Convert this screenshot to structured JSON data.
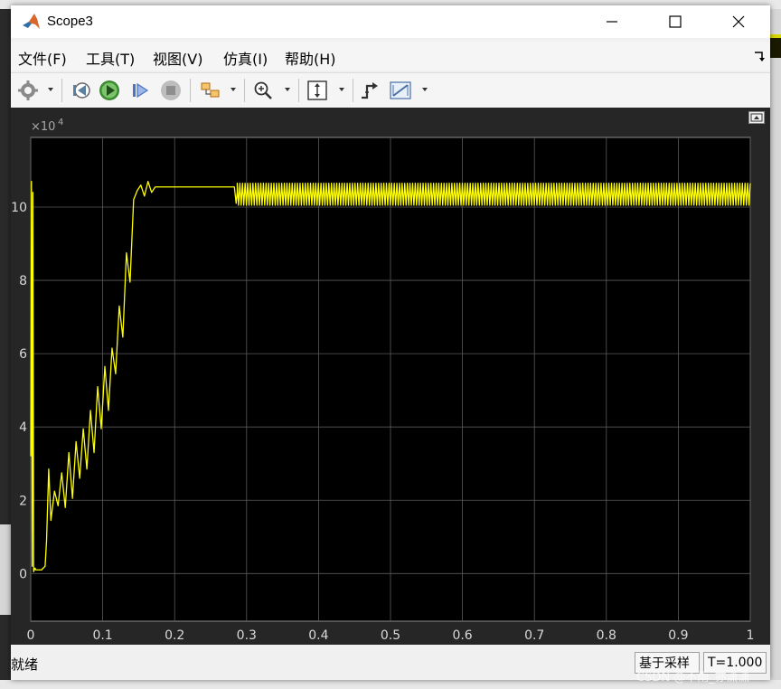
{
  "window": {
    "title": "Scope3",
    "logo_icon": "matlab-logo-icon"
  },
  "controls": {
    "minimize": "minimize-icon",
    "maximize": "maximize-icon",
    "close": "close-icon"
  },
  "menu": {
    "items": [
      "文件(F)",
      "工具(T)",
      "视图(V)",
      "仿真(I)",
      "帮助(H)"
    ]
  },
  "toolbar": {
    "icons": [
      "gear-icon",
      "step-back-icon",
      "run-icon",
      "step-forward-icon",
      "stop-icon",
      "highlight-block-icon",
      "zoom-in-icon",
      "autoscale-icon",
      "trigger-icon",
      "measure-icon"
    ]
  },
  "status": {
    "left": "就绪",
    "sample": "基于采样",
    "time": "T=1.000"
  },
  "watermark": "CSDN @不雨_亦潇潇",
  "colors": {
    "trace": "#ffff00",
    "plot_bg": "#000000",
    "figure_bg": "#262626",
    "grid": "#5a5a5a",
    "tick_text": "#d9d9d9"
  },
  "chart_data": {
    "type": "line",
    "title": "",
    "xlabel": "",
    "ylabel": "",
    "y_exponent_label": "×10",
    "y_exponent_power": "4",
    "xlim": [
      0,
      1
    ],
    "ylim": [
      -1.3,
      11.9
    ],
    "x_ticks": [
      0,
      0.1,
      0.2,
      0.3,
      0.4,
      0.5,
      0.6,
      0.7,
      0.8,
      0.9,
      1
    ],
    "x_tick_labels": [
      "0",
      "0.1",
      "0.2",
      "0.3",
      "0.4",
      "0.5",
      "0.6",
      "0.7",
      "0.8",
      "0.9",
      "1"
    ],
    "y_ticks": [
      0,
      2,
      4,
      6,
      8,
      10
    ],
    "y_tick_labels": [
      "0",
      "2",
      "4",
      "6",
      "8",
      "10"
    ],
    "grid": true,
    "series": [
      {
        "color": "#ffff00",
        "x": [
          0,
          0.001,
          0.002,
          0.003,
          0.004,
          0.005,
          0.006,
          0.007,
          0.01,
          0.015,
          0.02,
          0.022,
          0.025,
          0.028,
          0.033,
          0.038,
          0.043,
          0.048,
          0.053,
          0.058,
          0.063,
          0.068,
          0.073,
          0.078,
          0.083,
          0.088,
          0.093,
          0.098,
          0.103,
          0.108,
          0.113,
          0.118,
          0.123,
          0.128,
          0.133,
          0.138,
          0.143,
          0.148,
          0.153,
          0.158,
          0.163,
          0.168,
          0.173,
          0.178,
          0.183,
          0.188,
          0.193,
          0.198,
          0.203,
          0.208,
          0.213,
          0.218,
          0.223,
          0.228,
          0.233,
          0.238,
          0.243,
          0.248,
          0.253,
          0.258,
          0.263,
          0.268,
          0.273,
          0.278,
          0.283,
          0.2855,
          0.287
        ],
        "y": [
          3.2,
          10.7,
          0.2,
          10.4,
          0.05,
          0.1,
          0.15,
          0.1,
          0.1,
          0.1,
          0.2,
          0.9,
          2.85,
          1.45,
          2.25,
          1.85,
          2.75,
          1.8,
          3.3,
          2.05,
          3.6,
          2.6,
          3.95,
          2.85,
          4.45,
          3.3,
          5.1,
          3.95,
          5.65,
          4.45,
          6.15,
          5.45,
          7.3,
          6.45,
          8.75,
          7.95,
          10.2,
          10.45,
          10.6,
          10.3,
          10.7,
          10.4,
          10.55,
          10.55,
          10.55,
          10.55,
          10.55,
          10.55,
          10.55,
          10.55,
          10.55,
          10.55,
          10.55,
          10.55,
          10.55,
          10.55,
          10.55,
          10.55,
          10.55,
          10.55,
          10.55,
          10.55,
          10.55,
          10.55,
          10.55,
          10.1,
          10.4
        ],
        "oscillation": {
          "from": 0.287,
          "to": 1.0,
          "min": 10.05,
          "max": 10.65,
          "cycles": 196
        }
      }
    ]
  }
}
